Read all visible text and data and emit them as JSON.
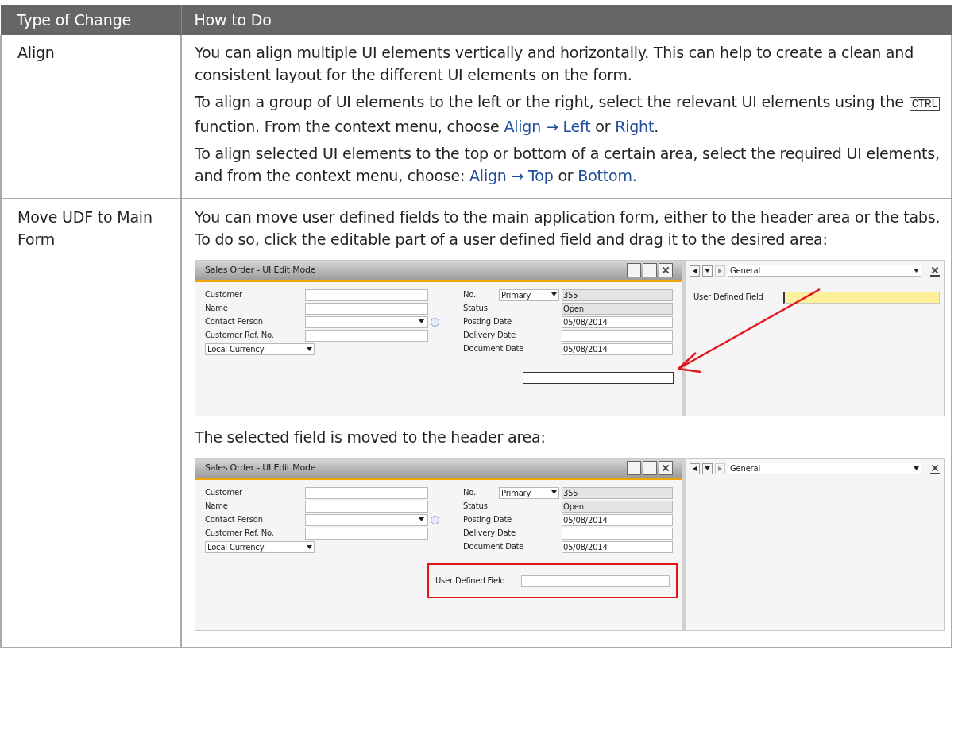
{
  "table": {
    "columns": [
      "Type of Change",
      "How to Do"
    ],
    "rows": [
      {
        "type": "Align",
        "blocks": [
          {
            "kind": "paragraph",
            "segments": [
              {
                "kind": "text",
                "text": "You can align multiple UI elements vertically and horizontally. This can help to create a clean and consistent layout for the different UI elements on the form."
              }
            ]
          },
          {
            "kind": "paragraph",
            "segments": [
              {
                "kind": "text",
                "text": "To align a group of UI elements to the left or the right, select the relevant UI elements using the "
              },
              {
                "kind": "key",
                "text": "CTRL"
              },
              {
                "kind": "text",
                "text": " function. From the context menu, choose "
              },
              {
                "kind": "menu",
                "text": "Align → Left"
              },
              {
                "kind": "text",
                "text": " or "
              },
              {
                "kind": "menu",
                "text": "Right"
              },
              {
                "kind": "text",
                "text": "."
              }
            ]
          },
          {
            "kind": "paragraph",
            "segments": [
              {
                "kind": "text",
                "text": "To align selected UI elements to the top or bottom of a certain area, select the required UI elements, and from the context menu, choose: "
              },
              {
                "kind": "menu",
                "text": "Align → Top"
              },
              {
                "kind": "text",
                "text": " or "
              },
              {
                "kind": "menu",
                "text": "Bottom."
              }
            ]
          }
        ]
      },
      {
        "type": "Move UDF to Main Form",
        "blocks": [
          {
            "kind": "paragraph",
            "segments": [
              {
                "kind": "text",
                "text": "You can move user defined fields to the main application form, either to the header area or the tabs. To do so, click the editable part of a user defined field and drag it to the desired area:"
              }
            ]
          },
          {
            "kind": "screenshot",
            "window_title": "Sales Order - UI Edit Mode",
            "left_fields": [
              {
                "label": "Customer",
                "kind": "text"
              },
              {
                "label": "Name",
                "kind": "text"
              },
              {
                "label": "Contact Person",
                "kind": "lookup"
              },
              {
                "label": "Customer Ref. No.",
                "kind": "text"
              }
            ],
            "currency": "Local Currency",
            "right_fields": [
              {
                "label": "No.",
                "select": "Primary",
                "value": "355",
                "readonly": true
              },
              {
                "label": "Status",
                "value": "Open",
                "readonly": true
              },
              {
                "label": "Posting Date",
                "value": "05/08/2014",
                "readonly": false
              },
              {
                "label": "Delivery Date",
                "readonly": false
              },
              {
                "label": "Document Date",
                "value": "05/08/2014",
                "readonly": false
              }
            ],
            "header_slot": {
              "kind": "empty"
            },
            "panel": {
              "tab": "General",
              "fields": [
                {
                  "label": "User Defined Field",
                  "focused": true
                }
              ]
            },
            "arrow": true
          },
          {
            "kind": "paragraph",
            "segments": [
              {
                "kind": "text",
                "text": "The selected field is moved to the header area:"
              }
            ]
          },
          {
            "kind": "screenshot",
            "window_title": "Sales Order - UI Edit Mode",
            "left_fields": [
              {
                "label": "Customer",
                "kind": "text"
              },
              {
                "label": "Name",
                "kind": "text"
              },
              {
                "label": "Contact Person",
                "kind": "lookup"
              },
              {
                "label": "Customer Ref. No.",
                "kind": "text"
              }
            ],
            "currency": "Local Currency",
            "right_fields": [
              {
                "label": "No.",
                "select": "Primary",
                "value": "355",
                "readonly": true
              },
              {
                "label": "Status",
                "value": "Open",
                "readonly": true
              },
              {
                "label": "Posting Date",
                "value": "05/08/2014",
                "readonly": false
              },
              {
                "label": "Delivery Date",
                "readonly": false
              },
              {
                "label": "Document Date",
                "value": "05/08/2014",
                "readonly": false
              }
            ],
            "header_slot": {
              "kind": "field",
              "label": "User Defined Field",
              "highlighted": true
            },
            "panel": {
              "tab": "General"
            },
            "arrow": false
          }
        ]
      }
    ]
  }
}
